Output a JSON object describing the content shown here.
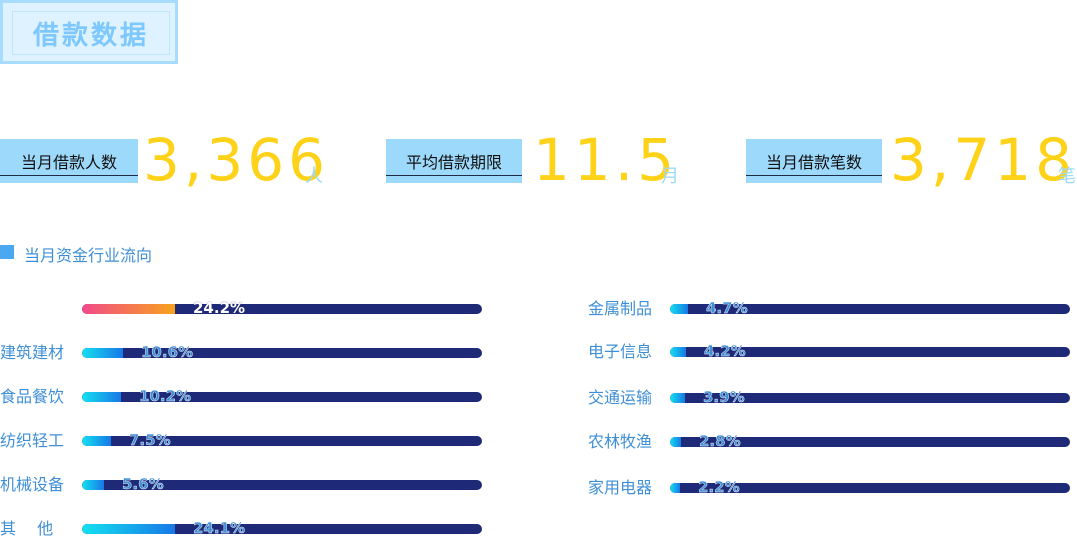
{
  "header": {
    "title": "借款数据"
  },
  "stats": [
    {
      "label": "当月借款人数",
      "value": "3,366",
      "unit": "人"
    },
    {
      "label": "平均借款期限",
      "value": "11.5",
      "unit": "月"
    },
    {
      "label": "当月借款笔数",
      "value": "3,718",
      "unit": "笔"
    }
  ],
  "section": {
    "title": "当月资金行业流向"
  },
  "industries_left": [
    {
      "label": "",
      "percent_text": "24.2%",
      "value": 24.2
    },
    {
      "label": "建筑建材",
      "percent_text": "10.6%",
      "value": 10.6
    },
    {
      "label": "食品餐饮",
      "percent_text": "10.2%",
      "value": 10.2
    },
    {
      "label": "纺织轻工",
      "percent_text": "7.5%",
      "value": 7.5
    },
    {
      "label": "机械设备",
      "percent_text": "5.6%",
      "value": 5.6
    },
    {
      "label": "其　 他",
      "percent_text": "24.1%",
      "value": 24.1
    }
  ],
  "industries_right": [
    {
      "label": "金属制品",
      "percent_text": "4.7%",
      "value": 4.7
    },
    {
      "label": "电子信息",
      "percent_text": "4.2%",
      "value": 4.2
    },
    {
      "label": "交通运输",
      "percent_text": "3.9%",
      "value": 3.9
    },
    {
      "label": "农林牧渔",
      "percent_text": "2.8%",
      "value": 2.8
    },
    {
      "label": "家用电器",
      "percent_text": "2.2%",
      "value": 2.2
    }
  ],
  "colors": {
    "track": "#1e2a78",
    "fill_start": "#14e0f0",
    "fill_end": "#1778e6",
    "highlight_start": "#f24a8a",
    "highlight_end": "#f7a31c",
    "value": "#ffd21a",
    "label_bg": "#9dd9fb",
    "text": "#3f8fd6"
  }
}
